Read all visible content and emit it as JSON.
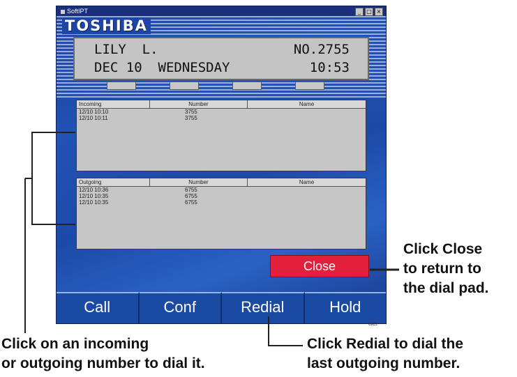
{
  "window": {
    "title": "SoftIPT"
  },
  "brand": "TOSHIBA",
  "lcd": {
    "name": "LILY  L.",
    "extension": "NO.2755",
    "date": "DEC 10  WEDNESDAY",
    "time": "10:53"
  },
  "incoming": {
    "headers": [
      "Incoming",
      "Number",
      "Name"
    ],
    "rows": [
      {
        "time": "12/10 10:10",
        "number": "3755",
        "name": ""
      },
      {
        "time": "12/10 10:11",
        "number": "3755",
        "name": ""
      }
    ]
  },
  "outgoing": {
    "headers": [
      "Outgoing",
      "Number",
      "Name"
    ],
    "rows": [
      {
        "time": "12/10 10:36",
        "number": "6755",
        "name": ""
      },
      {
        "time": "12/10 10:35",
        "number": "6755",
        "name": ""
      },
      {
        "time": "12/10 10:35",
        "number": "6755",
        "name": ""
      }
    ]
  },
  "close_label": "Close",
  "actions": [
    "Call",
    "Conf",
    "Redial",
    "Hold"
  ],
  "figure_number": "6922",
  "annotations": {
    "close": [
      "Click Close",
      "to return to",
      "the dial pad."
    ],
    "left": [
      "Click on an incoming",
      "or outgoing number to dial it."
    ],
    "redial": [
      "Click Redial to dial the",
      "last outgoing number."
    ]
  }
}
